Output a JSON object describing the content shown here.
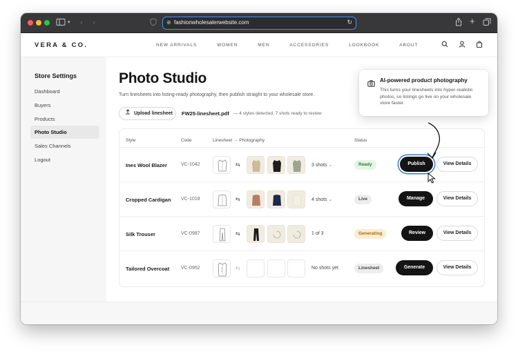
{
  "browser": {
    "url": "fashionwholesalerwebsite.com",
    "colors": {
      "close": "#ff5f57",
      "minimize": "#febc2e",
      "zoom": "#28c840"
    }
  },
  "brand": "VERA & CO.",
  "nav": {
    "links": [
      "NEW ARRIVALS",
      "WOMEN",
      "MEN",
      "ACCESSORIES",
      "LOOKBOOK",
      "ABOUT"
    ],
    "icons": [
      "search-icon",
      "user-icon",
      "shopping-bag-icon"
    ]
  },
  "sidebar": {
    "title": "Store Settings",
    "items": [
      {
        "label": "Dashboard",
        "active": false
      },
      {
        "label": "Buyers",
        "active": false
      },
      {
        "label": "Products",
        "active": false
      },
      {
        "label": "Photo Studio",
        "active": true
      },
      {
        "label": "Sales Channels",
        "active": false
      },
      {
        "label": "Logout",
        "active": false
      }
    ]
  },
  "main": {
    "title": "Photo Studio",
    "subtitle": "Turn linesheets into listing-ready photography, then publish straight to your wholesale store.",
    "upload_label": "Upload linesheet",
    "file_name": "FW25-linesheet.pdf",
    "file_meta": "— 4 styles detected, 7 shots ready to review"
  },
  "table": {
    "headers": {
      "style": "Style",
      "code": "Code",
      "linesheet": "Linesheet → Photography",
      "status": "Status"
    },
    "rows": [
      {
        "style": "Ines Wool Blazer",
        "code": "VC-1042",
        "shots": "3 shots",
        "shots_dropdown": true,
        "status": "Ready",
        "primary": "Publish",
        "secondary": "View Details"
      },
      {
        "style": "Cropped Cardigan",
        "code": "VC-1018",
        "shots": "4 shots",
        "shots_dropdown": true,
        "status": "Live",
        "primary": "Manage",
        "secondary": "View Details"
      },
      {
        "style": "Silk Trouser",
        "code": "VC-0987",
        "shots": "1 of 3",
        "shots_dropdown": false,
        "status": "Generating",
        "primary": "Review",
        "secondary": "View Details"
      },
      {
        "style": "Tailored Overcoat",
        "code": "VC-0952",
        "shots": "No shots yet",
        "shots_dropdown": false,
        "status": "Linesheet",
        "primary": "Generate",
        "secondary": "View Details"
      }
    ]
  },
  "tooltip": {
    "title": "AI-powered product photography",
    "text": "This turns your linesheets into hyper-realistic photos, so listings go live on your wholesale store faster.",
    "icon": "camera-icon"
  },
  "status_colors": {
    "Ready": {
      "bg": "#e3f5e5",
      "fg": "#2f7a3a"
    },
    "Live": {
      "bg": "#ededed",
      "fg": "#444444"
    },
    "Generating": {
      "bg": "#fbecd2",
      "fg": "#a56a12"
    },
    "Linesheet": {
      "bg": "#ededed",
      "fg": "#444444"
    }
  }
}
